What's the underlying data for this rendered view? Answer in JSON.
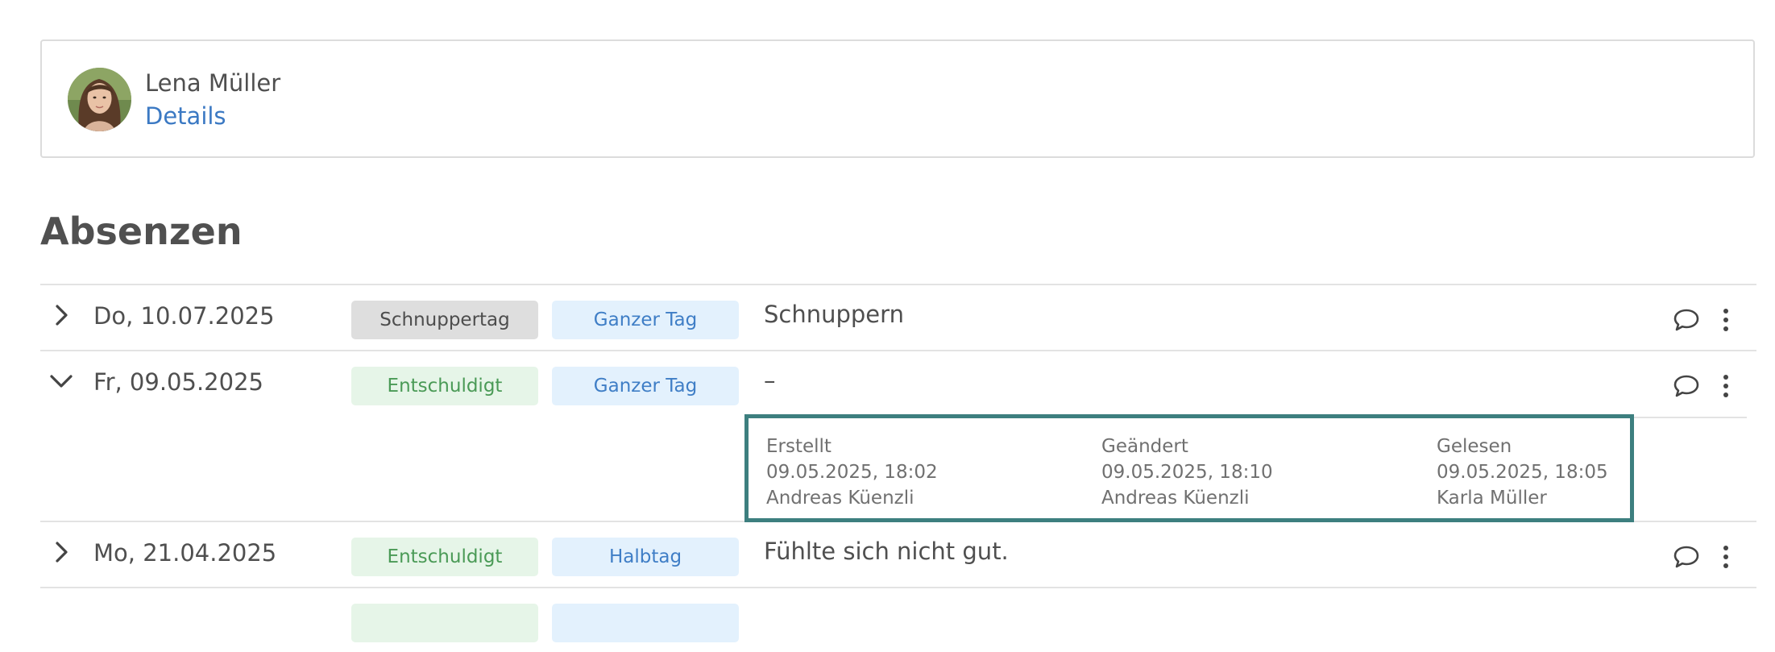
{
  "person": {
    "name": "Lena Müller",
    "details_link": "Details"
  },
  "section": {
    "title": "Absenzen"
  },
  "absences": [
    {
      "date": "Do, 10.07.2025",
      "type_badge": "Schnuppertag",
      "duration_badge": "Ganzer Tag",
      "comment": "Schnuppern",
      "expanded": false
    },
    {
      "date": "Fr, 09.05.2025",
      "type_badge": "Entschuldigt",
      "duration_badge": "Ganzer Tag",
      "comment": "–",
      "expanded": true,
      "meta": {
        "created": {
          "label": "Erstellt",
          "timestamp": "09.05.2025, 18:02",
          "by": "Andreas Küenzli"
        },
        "changed": {
          "label": "Geändert",
          "timestamp": "09.05.2025, 18:10",
          "by": "Andreas Küenzli"
        },
        "read": {
          "label": "Gelesen",
          "timestamp": "09.05.2025, 18:05",
          "by": "Karla Müller"
        }
      }
    },
    {
      "date": "Mo, 21.04.2025",
      "type_badge": "Entschuldigt",
      "duration_badge": "Halbtag",
      "comment": "Fühlte sich nicht gut.",
      "expanded": false
    }
  ],
  "icons": {
    "collapsed": "chevron-right-icon",
    "expanded": "chevron-down-icon",
    "comment": "comment-icon",
    "more": "more-vertical-icon"
  },
  "colors": {
    "link": "#3b79c3",
    "badge_grey": "#dedede",
    "badge_green_bg": "#e6f5e8",
    "badge_green_text": "#4a9a56",
    "badge_blue_bg": "#e3f1fd",
    "badge_blue_text": "#3f7ec6",
    "highlight_border": "#3d7f7f"
  }
}
